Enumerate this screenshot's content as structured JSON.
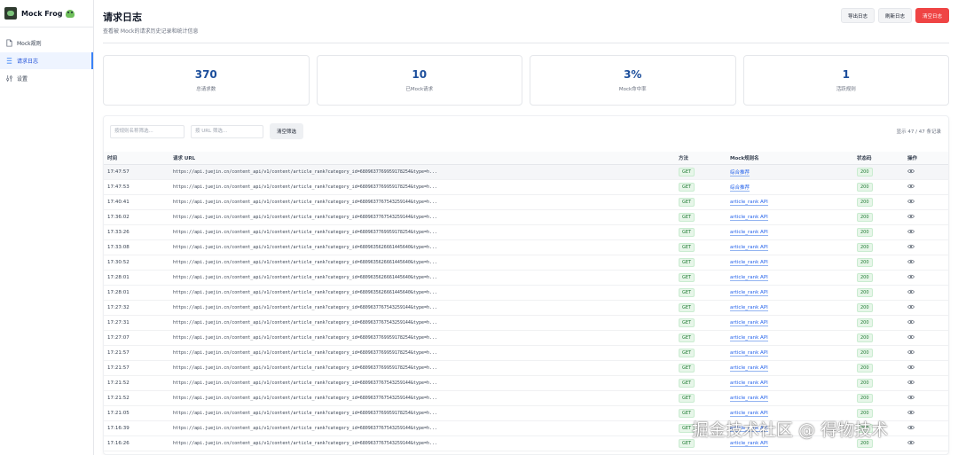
{
  "brand": {
    "title": "Mock Frog"
  },
  "sidebar": {
    "items": [
      {
        "label": "Mock规则",
        "icon": "document-icon",
        "active": false
      },
      {
        "label": "请求日志",
        "icon": "list-icon",
        "active": true
      },
      {
        "label": "设置",
        "icon": "settings-icon",
        "active": false
      }
    ]
  },
  "header": {
    "title": "请求日志",
    "subtitle": "查看被 Mock的请求历史记录和统计信息",
    "actions": {
      "export": "导出日志",
      "refresh": "刷新日志",
      "clear": "清空日志"
    }
  },
  "stats": [
    {
      "value": "370",
      "label": "总请求数"
    },
    {
      "value": "10",
      "label": "已Mock请求"
    },
    {
      "value": "3%",
      "label": "Mock命中率"
    },
    {
      "value": "1",
      "label": "活跃规则"
    }
  ],
  "filters": {
    "rule_placeholder": "按规则名称筛选...",
    "url_placeholder": "按 URL 筛选...",
    "clear_label": "清空筛选",
    "count_text": "显示 47 / 47 条记录"
  },
  "table": {
    "headers": {
      "time": "时间",
      "url": "请求 URL",
      "method": "方法",
      "rule": "Mock规则名",
      "status": "状态码",
      "op": "操作"
    },
    "rows": [
      {
        "time": "17:47:57",
        "url": "https://api.juejin.cn/content_api/v1/content/article_rank?category_id=6809637769959178254&type=h...",
        "method": "GET",
        "rule": "综合推荐",
        "status": "200"
      },
      {
        "time": "17:47:53",
        "url": "https://api.juejin.cn/content_api/v1/content/article_rank?category_id=6809637769959178254&type=h...",
        "method": "GET",
        "rule": "综合推荐",
        "status": "200"
      },
      {
        "time": "17:40:41",
        "url": "https://api.juejin.cn/content_api/v1/content/article_rank?category_id=6809637767543259144&type=h...",
        "method": "GET",
        "rule": "article_rank API",
        "status": "200"
      },
      {
        "time": "17:36:02",
        "url": "https://api.juejin.cn/content_api/v1/content/article_rank?category_id=6809637767543259144&type=h...",
        "method": "GET",
        "rule": "article_rank API",
        "status": "200"
      },
      {
        "time": "17:33:26",
        "url": "https://api.juejin.cn/content_api/v1/content/article_rank?category_id=6809637769959178254&type=h...",
        "method": "GET",
        "rule": "article_rank API",
        "status": "200"
      },
      {
        "time": "17:33:08",
        "url": "https://api.juejin.cn/content_api/v1/content/article_rank?category_id=6809635626661445640&type=h...",
        "method": "GET",
        "rule": "article_rank API",
        "status": "200"
      },
      {
        "time": "17:30:52",
        "url": "https://api.juejin.cn/content_api/v1/content/article_rank?category_id=6809635626661445640&type=h...",
        "method": "GET",
        "rule": "article_rank API",
        "status": "200"
      },
      {
        "time": "17:28:01",
        "url": "https://api.juejin.cn/content_api/v1/content/article_rank?category_id=6809635626661445640&type=h...",
        "method": "GET",
        "rule": "article_rank API",
        "status": "200"
      },
      {
        "time": "17:28:01",
        "url": "https://api.juejin.cn/content_api/v1/content/article_rank?category_id=6809635626661445640&type=h...",
        "method": "GET",
        "rule": "article_rank API",
        "status": "200"
      },
      {
        "time": "17:27:32",
        "url": "https://api.juejin.cn/content_api/v1/content/article_rank?category_id=6809637767543259144&type=h...",
        "method": "GET",
        "rule": "article_rank API",
        "status": "200"
      },
      {
        "time": "17:27:31",
        "url": "https://api.juejin.cn/content_api/v1/content/article_rank?category_id=6809637767543259144&type=h...",
        "method": "GET",
        "rule": "article_rank API",
        "status": "200"
      },
      {
        "time": "17:27:07",
        "url": "https://api.juejin.cn/content_api/v1/content/article_rank?category_id=6809637769959178254&type=h...",
        "method": "GET",
        "rule": "article_rank API",
        "status": "200"
      },
      {
        "time": "17:21:57",
        "url": "https://api.juejin.cn/content_api/v1/content/article_rank?category_id=6809637769959178254&type=h...",
        "method": "GET",
        "rule": "article_rank API",
        "status": "200"
      },
      {
        "time": "17:21:57",
        "url": "https://api.juejin.cn/content_api/v1/content/article_rank?category_id=6809637769959178254&type=h...",
        "method": "GET",
        "rule": "article_rank API",
        "status": "200"
      },
      {
        "time": "17:21:52",
        "url": "https://api.juejin.cn/content_api/v1/content/article_rank?category_id=6809637767543259144&type=h...",
        "method": "GET",
        "rule": "article_rank API",
        "status": "200"
      },
      {
        "time": "17:21:52",
        "url": "https://api.juejin.cn/content_api/v1/content/article_rank?category_id=6809637767543259144&type=h...",
        "method": "GET",
        "rule": "article_rank API",
        "status": "200"
      },
      {
        "time": "17:21:05",
        "url": "https://api.juejin.cn/content_api/v1/content/article_rank?category_id=6809637769959178254&type=h...",
        "method": "GET",
        "rule": "article_rank API",
        "status": "200"
      },
      {
        "time": "17:16:39",
        "url": "https://api.juejin.cn/content_api/v1/content/article_rank?category_id=6809637767543259144&type=h...",
        "method": "GET",
        "rule": "article_rank API",
        "status": "200"
      },
      {
        "time": "17:16:26",
        "url": "https://api.juejin.cn/content_api/v1/content/article_rank?category_id=6809637767543259144&type=h...",
        "method": "GET",
        "rule": "article_rank API",
        "status": "200"
      }
    ]
  },
  "watermark": "掘金技术社区 @ 得物技术",
  "colors": {
    "accent": "#1d4f9c",
    "danger": "#ef4444",
    "link": "#2563eb",
    "success": "#1f7a33"
  }
}
